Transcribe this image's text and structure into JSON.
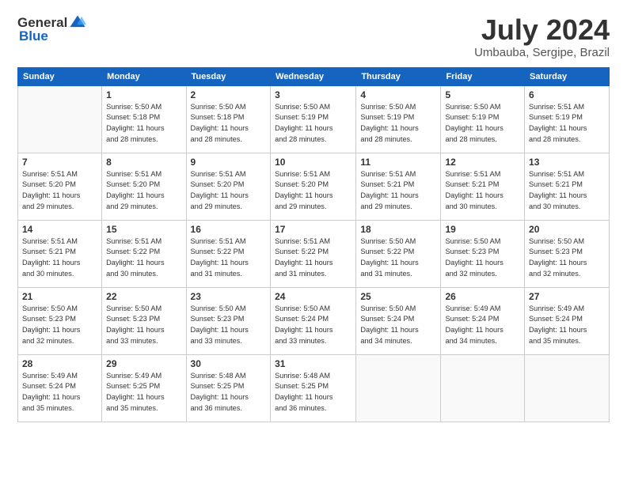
{
  "header": {
    "logo_general": "General",
    "logo_blue": "Blue",
    "title": "July 2024",
    "location": "Umbauba, Sergipe, Brazil"
  },
  "columns": [
    "Sunday",
    "Monday",
    "Tuesday",
    "Wednesday",
    "Thursday",
    "Friday",
    "Saturday"
  ],
  "weeks": [
    [
      {
        "day": "",
        "info": ""
      },
      {
        "day": "1",
        "info": "Sunrise: 5:50 AM\nSunset: 5:18 PM\nDaylight: 11 hours\nand 28 minutes."
      },
      {
        "day": "2",
        "info": "Sunrise: 5:50 AM\nSunset: 5:18 PM\nDaylight: 11 hours\nand 28 minutes."
      },
      {
        "day": "3",
        "info": "Sunrise: 5:50 AM\nSunset: 5:19 PM\nDaylight: 11 hours\nand 28 minutes."
      },
      {
        "day": "4",
        "info": "Sunrise: 5:50 AM\nSunset: 5:19 PM\nDaylight: 11 hours\nand 28 minutes."
      },
      {
        "day": "5",
        "info": "Sunrise: 5:50 AM\nSunset: 5:19 PM\nDaylight: 11 hours\nand 28 minutes."
      },
      {
        "day": "6",
        "info": "Sunrise: 5:51 AM\nSunset: 5:19 PM\nDaylight: 11 hours\nand 28 minutes."
      }
    ],
    [
      {
        "day": "7",
        "info": "Sunrise: 5:51 AM\nSunset: 5:20 PM\nDaylight: 11 hours\nand 29 minutes."
      },
      {
        "day": "8",
        "info": "Sunrise: 5:51 AM\nSunset: 5:20 PM\nDaylight: 11 hours\nand 29 minutes."
      },
      {
        "day": "9",
        "info": "Sunrise: 5:51 AM\nSunset: 5:20 PM\nDaylight: 11 hours\nand 29 minutes."
      },
      {
        "day": "10",
        "info": "Sunrise: 5:51 AM\nSunset: 5:20 PM\nDaylight: 11 hours\nand 29 minutes."
      },
      {
        "day": "11",
        "info": "Sunrise: 5:51 AM\nSunset: 5:21 PM\nDaylight: 11 hours\nand 29 minutes."
      },
      {
        "day": "12",
        "info": "Sunrise: 5:51 AM\nSunset: 5:21 PM\nDaylight: 11 hours\nand 30 minutes."
      },
      {
        "day": "13",
        "info": "Sunrise: 5:51 AM\nSunset: 5:21 PM\nDaylight: 11 hours\nand 30 minutes."
      }
    ],
    [
      {
        "day": "14",
        "info": "Sunrise: 5:51 AM\nSunset: 5:21 PM\nDaylight: 11 hours\nand 30 minutes."
      },
      {
        "day": "15",
        "info": "Sunrise: 5:51 AM\nSunset: 5:22 PM\nDaylight: 11 hours\nand 30 minutes."
      },
      {
        "day": "16",
        "info": "Sunrise: 5:51 AM\nSunset: 5:22 PM\nDaylight: 11 hours\nand 31 minutes."
      },
      {
        "day": "17",
        "info": "Sunrise: 5:51 AM\nSunset: 5:22 PM\nDaylight: 11 hours\nand 31 minutes."
      },
      {
        "day": "18",
        "info": "Sunrise: 5:50 AM\nSunset: 5:22 PM\nDaylight: 11 hours\nand 31 minutes."
      },
      {
        "day": "19",
        "info": "Sunrise: 5:50 AM\nSunset: 5:23 PM\nDaylight: 11 hours\nand 32 minutes."
      },
      {
        "day": "20",
        "info": "Sunrise: 5:50 AM\nSunset: 5:23 PM\nDaylight: 11 hours\nand 32 minutes."
      }
    ],
    [
      {
        "day": "21",
        "info": "Sunrise: 5:50 AM\nSunset: 5:23 PM\nDaylight: 11 hours\nand 32 minutes."
      },
      {
        "day": "22",
        "info": "Sunrise: 5:50 AM\nSunset: 5:23 PM\nDaylight: 11 hours\nand 33 minutes."
      },
      {
        "day": "23",
        "info": "Sunrise: 5:50 AM\nSunset: 5:23 PM\nDaylight: 11 hours\nand 33 minutes."
      },
      {
        "day": "24",
        "info": "Sunrise: 5:50 AM\nSunset: 5:24 PM\nDaylight: 11 hours\nand 33 minutes."
      },
      {
        "day": "25",
        "info": "Sunrise: 5:50 AM\nSunset: 5:24 PM\nDaylight: 11 hours\nand 34 minutes."
      },
      {
        "day": "26",
        "info": "Sunrise: 5:49 AM\nSunset: 5:24 PM\nDaylight: 11 hours\nand 34 minutes."
      },
      {
        "day": "27",
        "info": "Sunrise: 5:49 AM\nSunset: 5:24 PM\nDaylight: 11 hours\nand 35 minutes."
      }
    ],
    [
      {
        "day": "28",
        "info": "Sunrise: 5:49 AM\nSunset: 5:24 PM\nDaylight: 11 hours\nand 35 minutes."
      },
      {
        "day": "29",
        "info": "Sunrise: 5:49 AM\nSunset: 5:25 PM\nDaylight: 11 hours\nand 35 minutes."
      },
      {
        "day": "30",
        "info": "Sunrise: 5:48 AM\nSunset: 5:25 PM\nDaylight: 11 hours\nand 36 minutes."
      },
      {
        "day": "31",
        "info": "Sunrise: 5:48 AM\nSunset: 5:25 PM\nDaylight: 11 hours\nand 36 minutes."
      },
      {
        "day": "",
        "info": ""
      },
      {
        "day": "",
        "info": ""
      },
      {
        "day": "",
        "info": ""
      }
    ]
  ]
}
